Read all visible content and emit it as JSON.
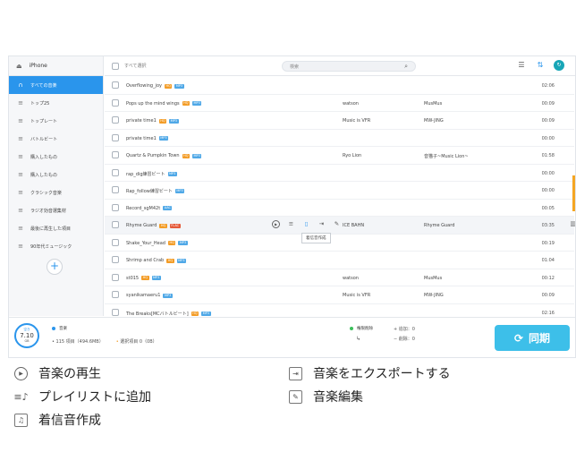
{
  "sidebar": {
    "device": "iPhone",
    "items": [
      {
        "label": "すべての音楽",
        "icon": "headphones-icon",
        "active": true
      },
      {
        "label": "トップ25",
        "icon": "playlist-icon"
      },
      {
        "label": "トップレート",
        "icon": "playlist-icon"
      },
      {
        "label": "バトルビート",
        "icon": "playlist-icon"
      },
      {
        "label": "購入したもの",
        "icon": "playlist-icon"
      },
      {
        "label": "購入したもの",
        "icon": "playlist-icon"
      },
      {
        "label": "クラシック音楽",
        "icon": "playlist-icon"
      },
      {
        "label": "ラジオ効音選集材",
        "icon": "playlist-icon"
      },
      {
        "label": "最後に再生した項目",
        "icon": "playlist-icon"
      },
      {
        "label": "90年代ミュージック",
        "icon": "playlist-icon"
      }
    ],
    "add": "+"
  },
  "toolbar": {
    "select_all": "すべて選択",
    "search_placeholder": "検索"
  },
  "rows": [
    {
      "title": "Overflowing_joy",
      "hq": "HQ",
      "fmt": "MP3",
      "artist": "",
      "album": "",
      "time": "02:06"
    },
    {
      "title": "Pops up the mind wings",
      "hq": "HQ",
      "fmt": "MP3",
      "artist": "watson",
      "album": "MusMus",
      "time": "00:09"
    },
    {
      "title": "private time1",
      "hq": "HQ",
      "fmt": "MP3",
      "artist": "Music is VFR",
      "album": "MW-JING",
      "time": "00:09"
    },
    {
      "title": "private time1",
      "hq": "",
      "fmt": "MP3",
      "artist": "",
      "album": "",
      "time": "00:00"
    },
    {
      "title": "Quartz & Pumpkin Town",
      "hq": "HQ",
      "fmt": "MP3",
      "artist": "Ryo Lion",
      "album": "音猫子~Music Lion~",
      "time": "01:58"
    },
    {
      "title": "rap_dig練習ビート",
      "hq": "",
      "fmt": "MP3",
      "artist": "",
      "album": "",
      "time": "00:00"
    },
    {
      "title": "Rap_follow練習ビート",
      "hq": "",
      "fmt": "MP3",
      "artist": "",
      "album": "",
      "time": "00:00"
    },
    {
      "title": "Record_sgM42t",
      "hq": "",
      "fmt": "AAC",
      "artist": "",
      "album": "",
      "time": "00:05"
    },
    {
      "title": "Rhyme Guard",
      "hq": "HQ",
      "fmt": "FLAC",
      "artist": "ICE BAHN",
      "album": "Rhyme Guard",
      "time": "03:35",
      "hover": true
    },
    {
      "title": "Shake_Your_Head",
      "hq": "HQ",
      "fmt": "MP3",
      "artist": "",
      "album": "",
      "time": "00:19"
    },
    {
      "title": "Shrimp and Crab",
      "hq": "HQ",
      "fmt": "MP3",
      "artist": "",
      "album": "",
      "time": "01:04"
    },
    {
      "title": "st015",
      "hq": "HQ",
      "fmt": "MP3",
      "artist": "watson",
      "album": "MusMus",
      "time": "00:12"
    },
    {
      "title": "syanikamaeru1",
      "hq": "",
      "fmt": "MP3",
      "artist": "Music is VFR",
      "album": "MW-JING",
      "time": "00:09"
    },
    {
      "title": "The Breaks[MCバトルビート]",
      "hq": "HQ",
      "fmt": "MP3",
      "artist": "",
      "album": "",
      "time": "02:16"
    }
  ],
  "tooltip": "着信音作成",
  "footer": {
    "storage_label": "空き",
    "storage_value": "7.10",
    "storage_unit": "GB",
    "type_label": "音楽",
    "items": "115 項目（494.6MB）",
    "selected": "選択項目 0（0B）",
    "delete_label": "権限削除",
    "added": "+ 追加：0",
    "removed": "− 削除：0",
    "sync": "同期",
    "colors": {
      "music_dot": "#2a95ec",
      "delete_dot": "#3cbf5b",
      "sync_bg": "#3dbfe9"
    }
  },
  "legend": {
    "play": "音楽の再生",
    "playlist": "プレイリストに追加",
    "ringtone": "着信音作成",
    "export": "音楽をエクスポートする",
    "edit": "音楽編集"
  }
}
